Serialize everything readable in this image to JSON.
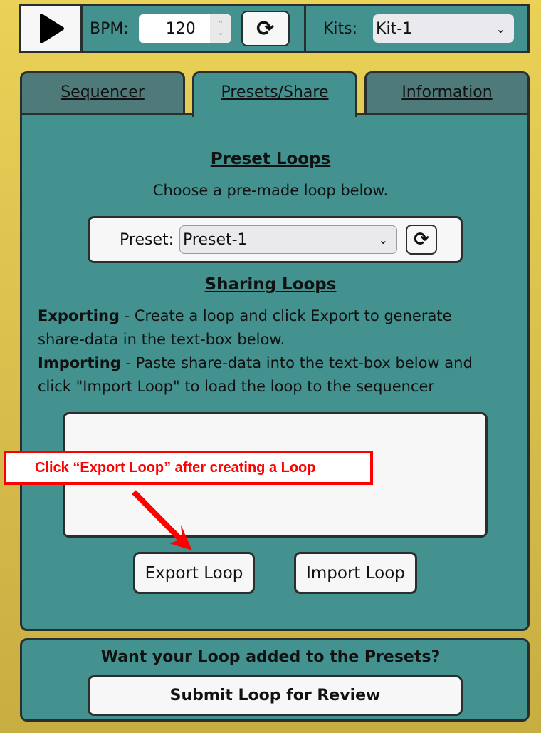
{
  "toolbar": {
    "bpm_label": "BPM:",
    "bpm_value": "120",
    "kits_label": "Kits:",
    "kit_selected": "Kit-1"
  },
  "tabs": [
    {
      "label": "Sequencer"
    },
    {
      "label": "Presets/Share"
    },
    {
      "label": "Information"
    }
  ],
  "presets": {
    "heading": "Preset Loops",
    "subtitle": "Choose a pre-made loop below.",
    "label": "Preset:",
    "selected": "Preset-1"
  },
  "sharing": {
    "heading": "Sharing Loops",
    "export_bold": "Exporting",
    "export_text": " - Create a loop and click Export to generate share-data in the text-box below.",
    "import_bold": "Importing",
    "import_text": " - Paste share-data into the text-box below and click \"Import Loop\" to load the loop to the sequencer",
    "textarea_value": "",
    "export_button": "Export Loop",
    "import_button": "Import Loop"
  },
  "callout": {
    "text": "Click “Export Loop” after creating a Loop",
    "color": "#ff0000"
  },
  "submit": {
    "prompt": "Want your Loop added to the Presets?",
    "button": "Submit Loop for Review"
  }
}
